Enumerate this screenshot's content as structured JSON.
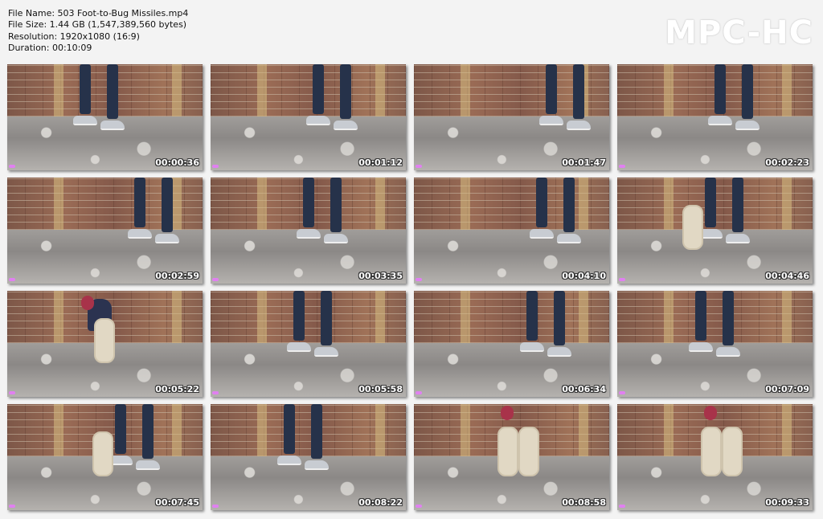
{
  "info": {
    "file_name": "File Name: 503 Foot-to-Bug Missiles.mp4",
    "file_size": "File Size: 1.44 GB (1,547,389,560 bytes)",
    "resolution": "Resolution: 1920x1080 (16:9)",
    "duration": "Duration: 00:10:09"
  },
  "logo": "MPC-HC",
  "thumbnails": [
    {
      "time": "00:00:36",
      "scene": "legs"
    },
    {
      "time": "00:01:12",
      "scene": "legs"
    },
    {
      "time": "00:01:47",
      "scene": "legs"
    },
    {
      "time": "00:02:23",
      "scene": "legs"
    },
    {
      "time": "00:02:59",
      "scene": "legs"
    },
    {
      "time": "00:03:35",
      "scene": "legs"
    },
    {
      "time": "00:04:10",
      "scene": "legs"
    },
    {
      "time": "00:04:46",
      "scene": "legs-sole"
    },
    {
      "time": "00:05:22",
      "scene": "sitting"
    },
    {
      "time": "00:05:58",
      "scene": "legs"
    },
    {
      "time": "00:06:34",
      "scene": "legs"
    },
    {
      "time": "00:07:09",
      "scene": "legs"
    },
    {
      "time": "00:07:45",
      "scene": "legs-sole"
    },
    {
      "time": "00:08:22",
      "scene": "legs"
    },
    {
      "time": "00:08:58",
      "scene": "soles"
    },
    {
      "time": "00:09:33",
      "scene": "soles"
    }
  ]
}
